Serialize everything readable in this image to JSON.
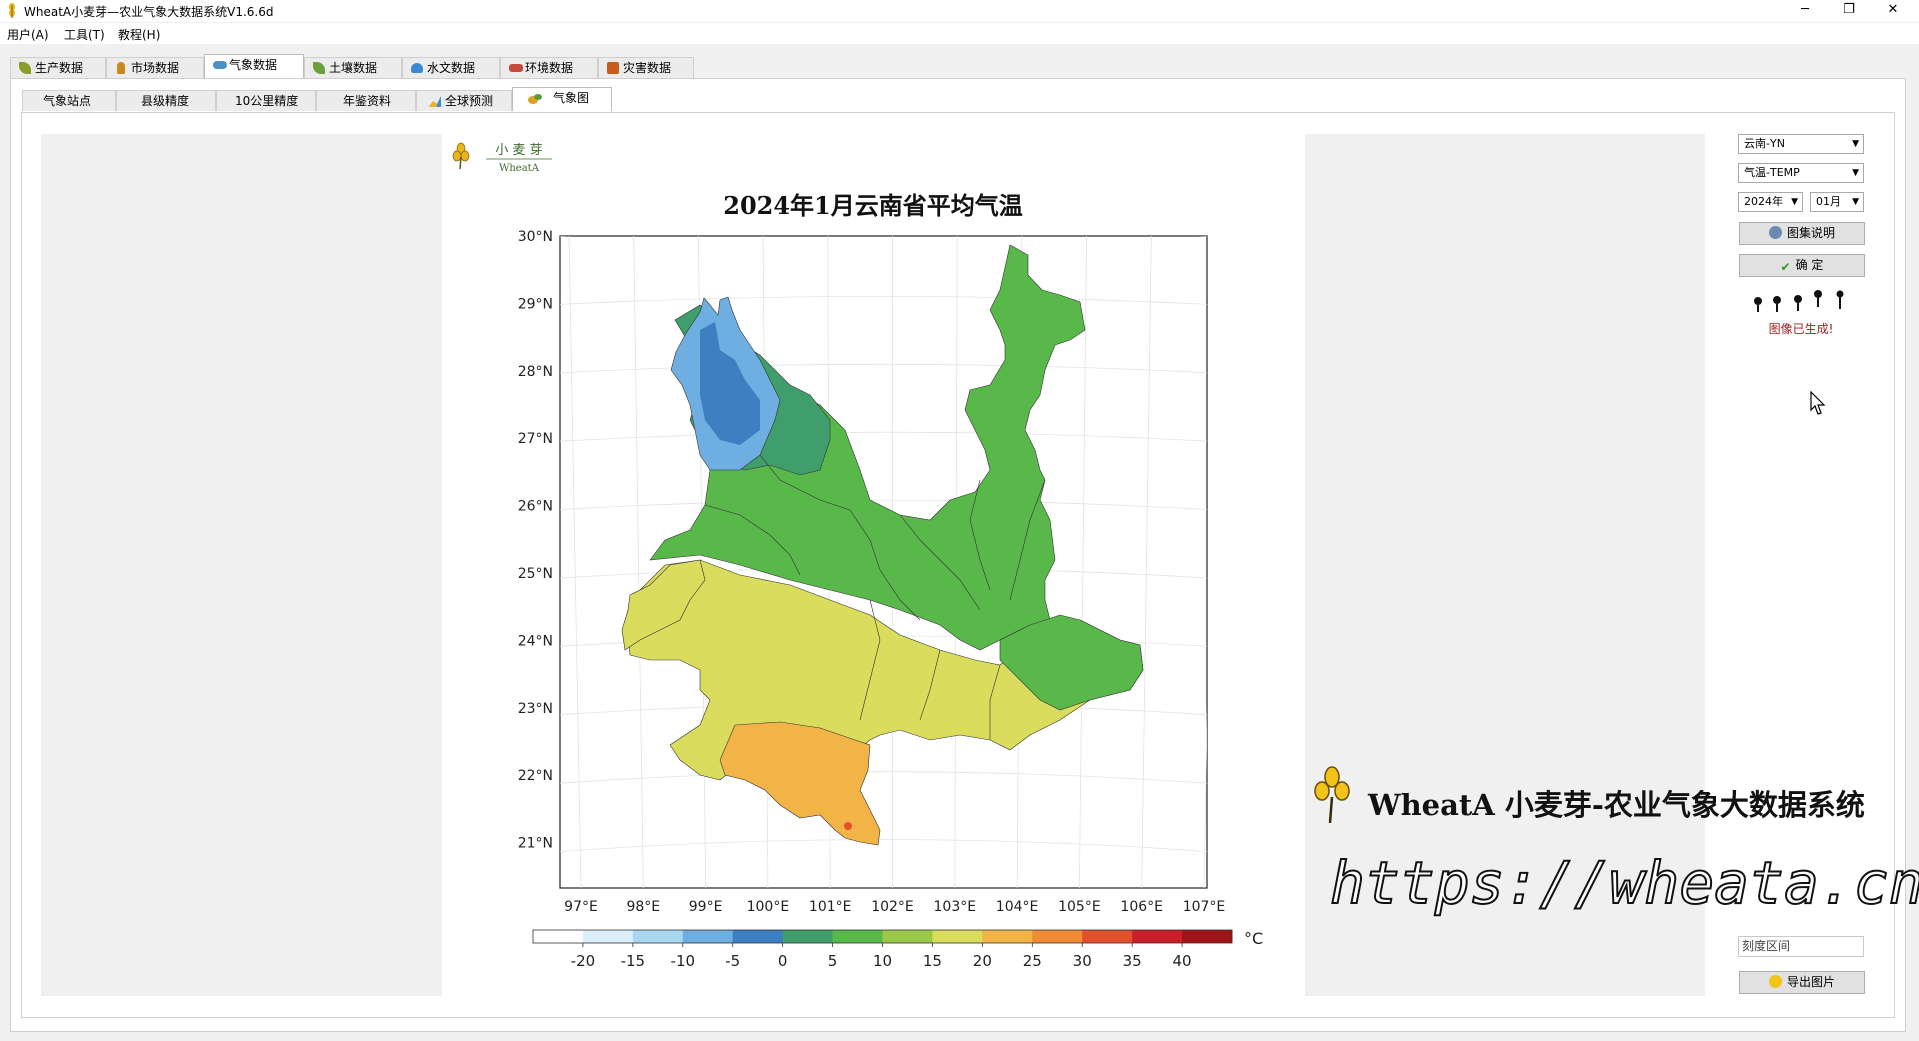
{
  "window": {
    "title": "WheatA小麦芽—农业气象大数据系统V1.6.6d",
    "minimize": "─",
    "maximize": "❐",
    "close": "✕"
  },
  "menu": [
    "用户(A)",
    "工具(T)",
    "教程(H)"
  ],
  "main_tabs": [
    {
      "label": "生产数据",
      "icon": "leaf-icon",
      "color": "#8b9e2b"
    },
    {
      "label": "市场数据",
      "icon": "wheat-icon",
      "color": "#c98a1d"
    },
    {
      "label": "气象数据",
      "icon": "cloud-icon",
      "color": "#4a90c8",
      "active": true
    },
    {
      "label": "土壤数据",
      "icon": "soil-icon",
      "color": "#6aa13a"
    },
    {
      "label": "水文数据",
      "icon": "water-icon",
      "color": "#3b8ad0"
    },
    {
      "label": "环境数据",
      "icon": "car-icon",
      "color": "#c84a3a"
    },
    {
      "label": "灾害数据",
      "icon": "disaster-icon",
      "color": "#c85c1a"
    }
  ],
  "sub_tabs": [
    {
      "label": "气象站点"
    },
    {
      "label": "县级精度"
    },
    {
      "label": "10公里精度"
    },
    {
      "label": "年鉴资料"
    },
    {
      "label": "全球预测",
      "icon": "chart-icon"
    },
    {
      "label": "气象图",
      "icon": "map-icon",
      "active": true
    }
  ],
  "controls": {
    "region": "云南-YN",
    "variable": "气温-TEMP",
    "year": "2024年",
    "month": "01月",
    "legend_button": "图集说明",
    "confirm_button": "确  定",
    "status": "图像已生成!",
    "range_placeholder": "刻度区间",
    "export_button": "导出图片"
  },
  "logo": {
    "cn": "小 麦 芽",
    "en": "WheatA"
  },
  "watermark": {
    "title": "WheatA 小麦芽-农业气象大数据系统",
    "url": "https://wheata.cn"
  },
  "chart_data": {
    "type": "heatmap",
    "title": "2024年1月云南省平均气温",
    "x_ticks": [
      "97°E",
      "98°E",
      "99°E",
      "100°E",
      "101°E",
      "102°E",
      "103°E",
      "104°E",
      "105°E",
      "106°E",
      "107°E"
    ],
    "y_ticks": [
      "30°N",
      "29°N",
      "28°N",
      "27°N",
      "26°N",
      "25°N",
      "24°N",
      "23°N",
      "22°N",
      "21°N"
    ],
    "colorbar": {
      "unit": "°C",
      "ticks": [
        "-20",
        "-15",
        "-10",
        "-5",
        "0",
        "5",
        "10",
        "15",
        "20",
        "25",
        "30",
        "35",
        "40"
      ],
      "colors": [
        "#ffffff",
        "#dcf0fb",
        "#a8d8f0",
        "#6eaee0",
        "#3d7fc1",
        "#3f9e6b",
        "#58b84a",
        "#9cc84a",
        "#d9dc5c",
        "#f2b347",
        "#ee8b34",
        "#e2502c",
        "#c91f2a",
        "#9e1418"
      ]
    }
  }
}
